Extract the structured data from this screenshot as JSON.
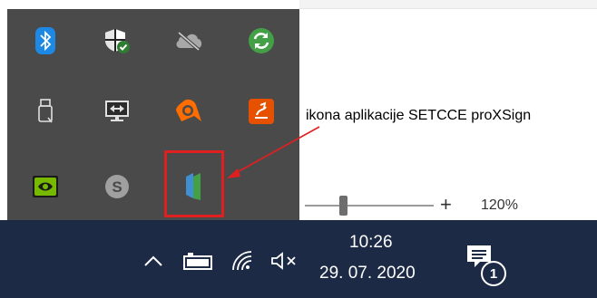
{
  "annotation": {
    "text": "ikona aplikacije SETCCE proXSign",
    "color": "#e02020"
  },
  "tray_overflow": {
    "background": "#4a4a4a",
    "icons": [
      {
        "name": "bluetooth-icon",
        "color": "#1e88e5"
      },
      {
        "name": "windows-security-icon",
        "color": "#2e7d32"
      },
      {
        "name": "onedrive-offline-icon",
        "color": "#9e9e9e"
      },
      {
        "name": "sync-icon",
        "color": "#43a047"
      },
      {
        "name": "usb-device-icon",
        "color": "#e0e0e0"
      },
      {
        "name": "remote-display-icon",
        "color": "#e0e0e0"
      },
      {
        "name": "avast-icon",
        "color": "#ff6d00"
      },
      {
        "name": "sublime-app-icon",
        "color": "#e65100"
      },
      {
        "name": "nvidia-icon",
        "color": "#76b900"
      },
      {
        "name": "skype-icon",
        "color": "#a0a0a0"
      },
      {
        "name": "proxsign-icon",
        "color": "#3f8fd2"
      }
    ]
  },
  "zoom": {
    "plus_label": "+",
    "value": "120%",
    "level_fraction": 0.3
  },
  "taskbar": {
    "background": "#1c2a45",
    "time": "10:26",
    "date": "29. 07. 2020",
    "notification_count": "1"
  }
}
